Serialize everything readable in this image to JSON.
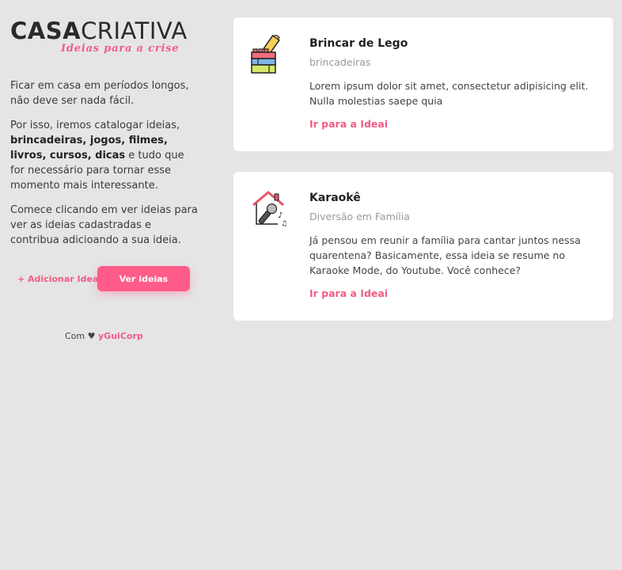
{
  "logo": {
    "part_bold": "CASA",
    "part_light": "CRIATIVA",
    "tagline": "Ideias para a crise"
  },
  "intro": {
    "p1": "Ficar em casa em períodos longos, não deve ser nada fácil.",
    "p2_prefix": "Por isso, iremos catalogar ideias,",
    "p2_bold": "brincadeiras, jogos, filmes, livros, cursos, dicas",
    "p2_suffix": "e tudo que for necessário para tornar esse momento mais interessante.",
    "p3": "Comece clicando em ver ideias para ver as ideias cadastradas e contribua adicioando a sua ideia."
  },
  "actions": {
    "add_label": "+ Adicionar Ideai",
    "view_label": "Ver ideias"
  },
  "footer": {
    "prefix": "Com",
    "heart": "♥",
    "author": "yGuiCorp"
  },
  "cards": [
    {
      "title": "Brincar de Lego",
      "category": "brincadeiras",
      "description": "Lorem ipsum dolor sit amet, consectetur adipisicing elit. Nulla molestias saepe quia",
      "link": "Ir para a Ideai",
      "icon": "lego-icon"
    },
    {
      "title": "Karaokê",
      "category": "Diversão em Família",
      "description": "Já pensou em reunir a família para cantar juntos nessa quarentena? Basicamente, essa ideia se resume no Karaoke Mode, do Youtube. Você conhece?",
      "link": "Ir para a Ideai",
      "icon": "karaoke-icon"
    }
  ],
  "colors": {
    "accent": "#ff5c8a",
    "background": "#e5e5e5",
    "card": "#ffffff"
  }
}
